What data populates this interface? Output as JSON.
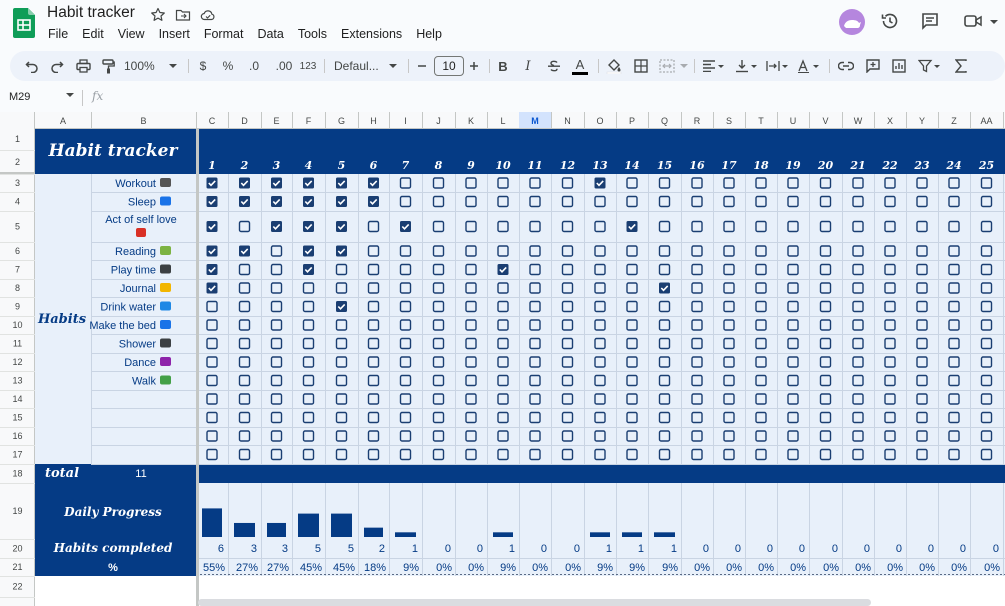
{
  "app": {
    "title": "Habit tracker",
    "menu": [
      "File",
      "Edit",
      "View",
      "Insert",
      "Format",
      "Data",
      "Tools",
      "Extensions",
      "Help"
    ]
  },
  "toolbar": {
    "zoom": "100%",
    "currency": "$",
    "percent": "%",
    "decrease_decimal": ".0",
    "increase_decimal": ".00",
    "number_format": "123",
    "font": "Defaul...",
    "font_size": "10",
    "bold": "B",
    "italic": "I",
    "text_color_letter": "A"
  },
  "formula_bar": {
    "name_box": "M29",
    "fx": "fx"
  },
  "sheet": {
    "columns": [
      "A",
      "B",
      "C",
      "D",
      "E",
      "F",
      "G",
      "H",
      "I",
      "J",
      "K",
      "L",
      "M",
      "N",
      "O",
      "P",
      "Q",
      "R",
      "S",
      "T",
      "U",
      "V",
      "W",
      "X",
      "Y",
      "Z",
      "AA"
    ],
    "selected_column": "M",
    "rows": [
      "1",
      "2",
      "3",
      "4",
      "5",
      "6",
      "7",
      "8",
      "9",
      "10",
      "11",
      "12",
      "13",
      "14",
      "15",
      "16",
      "17",
      "18",
      "19",
      "20",
      "21",
      "22"
    ],
    "banner_title": "Habit tracker",
    "section_label": "Habits",
    "total_label": "total",
    "total_value": "11",
    "progress_label": "Daily Progress",
    "completed_label": "Habits completed",
    "percent_label": "%",
    "days": [
      "1",
      "2",
      "3",
      "4",
      "5",
      "6",
      "7",
      "8",
      "9",
      "10",
      "11",
      "12",
      "13",
      "14",
      "15",
      "16",
      "17",
      "18",
      "19",
      "20",
      "21",
      "22",
      "23",
      "24",
      "25"
    ],
    "habits": [
      {
        "name": "Workout",
        "icon": "sneaker-icon"
      },
      {
        "name": "Sleep",
        "icon": "bed-icon"
      },
      {
        "name": "Act of self love",
        "icon": "heart-icon"
      },
      {
        "name": "Reading",
        "icon": "books-icon"
      },
      {
        "name": "Play time",
        "icon": "game-controller-icon"
      },
      {
        "name": "Journal",
        "icon": "memo-icon"
      },
      {
        "name": "Drink water",
        "icon": "droplet-icon"
      },
      {
        "name": "Make the bed",
        "icon": "bed-arrow-icon"
      },
      {
        "name": "Shower",
        "icon": "shower-icon"
      },
      {
        "name": "Dance",
        "icon": "music-icon"
      },
      {
        "name": "Walk",
        "icon": "mountain-icon"
      },
      {
        "name": "",
        "icon": ""
      },
      {
        "name": "",
        "icon": ""
      },
      {
        "name": "",
        "icon": ""
      },
      {
        "name": "",
        "icon": ""
      }
    ],
    "checked": [
      [
        1,
        2,
        3,
        4,
        5,
        6,
        13
      ],
      [
        1,
        2,
        3,
        4,
        5,
        6
      ],
      [
        1,
        3,
        4,
        5,
        7,
        14
      ],
      [
        1,
        2,
        4,
        5
      ],
      [
        1,
        4,
        10
      ],
      [
        1,
        15
      ],
      [
        5
      ],
      [],
      [],
      [],
      [],
      [],
      [],
      [],
      []
    ],
    "habits_completed": [
      "6",
      "3",
      "3",
      "5",
      "5",
      "2",
      "1",
      "0",
      "0",
      "1",
      "0",
      "0",
      "1",
      "1",
      "1",
      "0",
      "0",
      "0",
      "0",
      "0",
      "0",
      "0",
      "0",
      "0",
      "0"
    ],
    "percent_completed": [
      "55%",
      "27%",
      "27%",
      "45%",
      "45%",
      "18%",
      "9%",
      "0%",
      "0%",
      "9%",
      "0%",
      "0%",
      "9%",
      "9%",
      "9%",
      "0%",
      "0%",
      "0%",
      "0%",
      "0%",
      "0%",
      "0%",
      "0%",
      "0%",
      "0%"
    ],
    "daily_progress": [
      0.55,
      0.27,
      0.27,
      0.45,
      0.45,
      0.18,
      0.09,
      0,
      0,
      0.09,
      0,
      0,
      0.09,
      0.09,
      0.09,
      0,
      0,
      0,
      0,
      0,
      0,
      0,
      0,
      0,
      0
    ]
  },
  "colors": {
    "navy": "#053b85",
    "light_blue": "#e8f0fa",
    "checkbox": "#1a3e72",
    "header_bg": "#f8f9fa",
    "selected_header": "#d3e3fd"
  }
}
